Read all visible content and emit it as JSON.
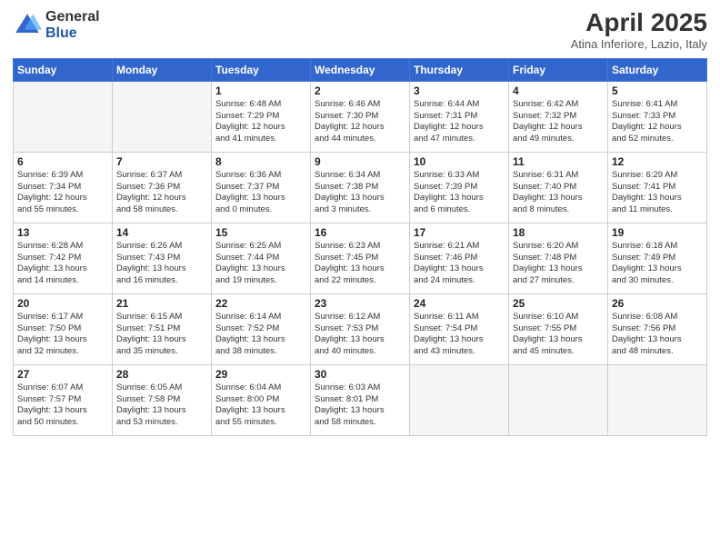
{
  "logo": {
    "general": "General",
    "blue": "Blue"
  },
  "title": "April 2025",
  "subtitle": "Atina Inferiore, Lazio, Italy",
  "weekdays": [
    "Sunday",
    "Monday",
    "Tuesday",
    "Wednesday",
    "Thursday",
    "Friday",
    "Saturday"
  ],
  "weeks": [
    [
      {
        "day": "",
        "detail": ""
      },
      {
        "day": "",
        "detail": ""
      },
      {
        "day": "1",
        "detail": "Sunrise: 6:48 AM\nSunset: 7:29 PM\nDaylight: 12 hours\nand 41 minutes."
      },
      {
        "day": "2",
        "detail": "Sunrise: 6:46 AM\nSunset: 7:30 PM\nDaylight: 12 hours\nand 44 minutes."
      },
      {
        "day": "3",
        "detail": "Sunrise: 6:44 AM\nSunset: 7:31 PM\nDaylight: 12 hours\nand 47 minutes."
      },
      {
        "day": "4",
        "detail": "Sunrise: 6:42 AM\nSunset: 7:32 PM\nDaylight: 12 hours\nand 49 minutes."
      },
      {
        "day": "5",
        "detail": "Sunrise: 6:41 AM\nSunset: 7:33 PM\nDaylight: 12 hours\nand 52 minutes."
      }
    ],
    [
      {
        "day": "6",
        "detail": "Sunrise: 6:39 AM\nSunset: 7:34 PM\nDaylight: 12 hours\nand 55 minutes."
      },
      {
        "day": "7",
        "detail": "Sunrise: 6:37 AM\nSunset: 7:36 PM\nDaylight: 12 hours\nand 58 minutes."
      },
      {
        "day": "8",
        "detail": "Sunrise: 6:36 AM\nSunset: 7:37 PM\nDaylight: 13 hours\nand 0 minutes."
      },
      {
        "day": "9",
        "detail": "Sunrise: 6:34 AM\nSunset: 7:38 PM\nDaylight: 13 hours\nand 3 minutes."
      },
      {
        "day": "10",
        "detail": "Sunrise: 6:33 AM\nSunset: 7:39 PM\nDaylight: 13 hours\nand 6 minutes."
      },
      {
        "day": "11",
        "detail": "Sunrise: 6:31 AM\nSunset: 7:40 PM\nDaylight: 13 hours\nand 8 minutes."
      },
      {
        "day": "12",
        "detail": "Sunrise: 6:29 AM\nSunset: 7:41 PM\nDaylight: 13 hours\nand 11 minutes."
      }
    ],
    [
      {
        "day": "13",
        "detail": "Sunrise: 6:28 AM\nSunset: 7:42 PM\nDaylight: 13 hours\nand 14 minutes."
      },
      {
        "day": "14",
        "detail": "Sunrise: 6:26 AM\nSunset: 7:43 PM\nDaylight: 13 hours\nand 16 minutes."
      },
      {
        "day": "15",
        "detail": "Sunrise: 6:25 AM\nSunset: 7:44 PM\nDaylight: 13 hours\nand 19 minutes."
      },
      {
        "day": "16",
        "detail": "Sunrise: 6:23 AM\nSunset: 7:45 PM\nDaylight: 13 hours\nand 22 minutes."
      },
      {
        "day": "17",
        "detail": "Sunrise: 6:21 AM\nSunset: 7:46 PM\nDaylight: 13 hours\nand 24 minutes."
      },
      {
        "day": "18",
        "detail": "Sunrise: 6:20 AM\nSunset: 7:48 PM\nDaylight: 13 hours\nand 27 minutes."
      },
      {
        "day": "19",
        "detail": "Sunrise: 6:18 AM\nSunset: 7:49 PM\nDaylight: 13 hours\nand 30 minutes."
      }
    ],
    [
      {
        "day": "20",
        "detail": "Sunrise: 6:17 AM\nSunset: 7:50 PM\nDaylight: 13 hours\nand 32 minutes."
      },
      {
        "day": "21",
        "detail": "Sunrise: 6:15 AM\nSunset: 7:51 PM\nDaylight: 13 hours\nand 35 minutes."
      },
      {
        "day": "22",
        "detail": "Sunrise: 6:14 AM\nSunset: 7:52 PM\nDaylight: 13 hours\nand 38 minutes."
      },
      {
        "day": "23",
        "detail": "Sunrise: 6:12 AM\nSunset: 7:53 PM\nDaylight: 13 hours\nand 40 minutes."
      },
      {
        "day": "24",
        "detail": "Sunrise: 6:11 AM\nSunset: 7:54 PM\nDaylight: 13 hours\nand 43 minutes."
      },
      {
        "day": "25",
        "detail": "Sunrise: 6:10 AM\nSunset: 7:55 PM\nDaylight: 13 hours\nand 45 minutes."
      },
      {
        "day": "26",
        "detail": "Sunrise: 6:08 AM\nSunset: 7:56 PM\nDaylight: 13 hours\nand 48 minutes."
      }
    ],
    [
      {
        "day": "27",
        "detail": "Sunrise: 6:07 AM\nSunset: 7:57 PM\nDaylight: 13 hours\nand 50 minutes."
      },
      {
        "day": "28",
        "detail": "Sunrise: 6:05 AM\nSunset: 7:58 PM\nDaylight: 13 hours\nand 53 minutes."
      },
      {
        "day": "29",
        "detail": "Sunrise: 6:04 AM\nSunset: 8:00 PM\nDaylight: 13 hours\nand 55 minutes."
      },
      {
        "day": "30",
        "detail": "Sunrise: 6:03 AM\nSunset: 8:01 PM\nDaylight: 13 hours\nand 58 minutes."
      },
      {
        "day": "",
        "detail": ""
      },
      {
        "day": "",
        "detail": ""
      },
      {
        "day": "",
        "detail": ""
      }
    ]
  ]
}
